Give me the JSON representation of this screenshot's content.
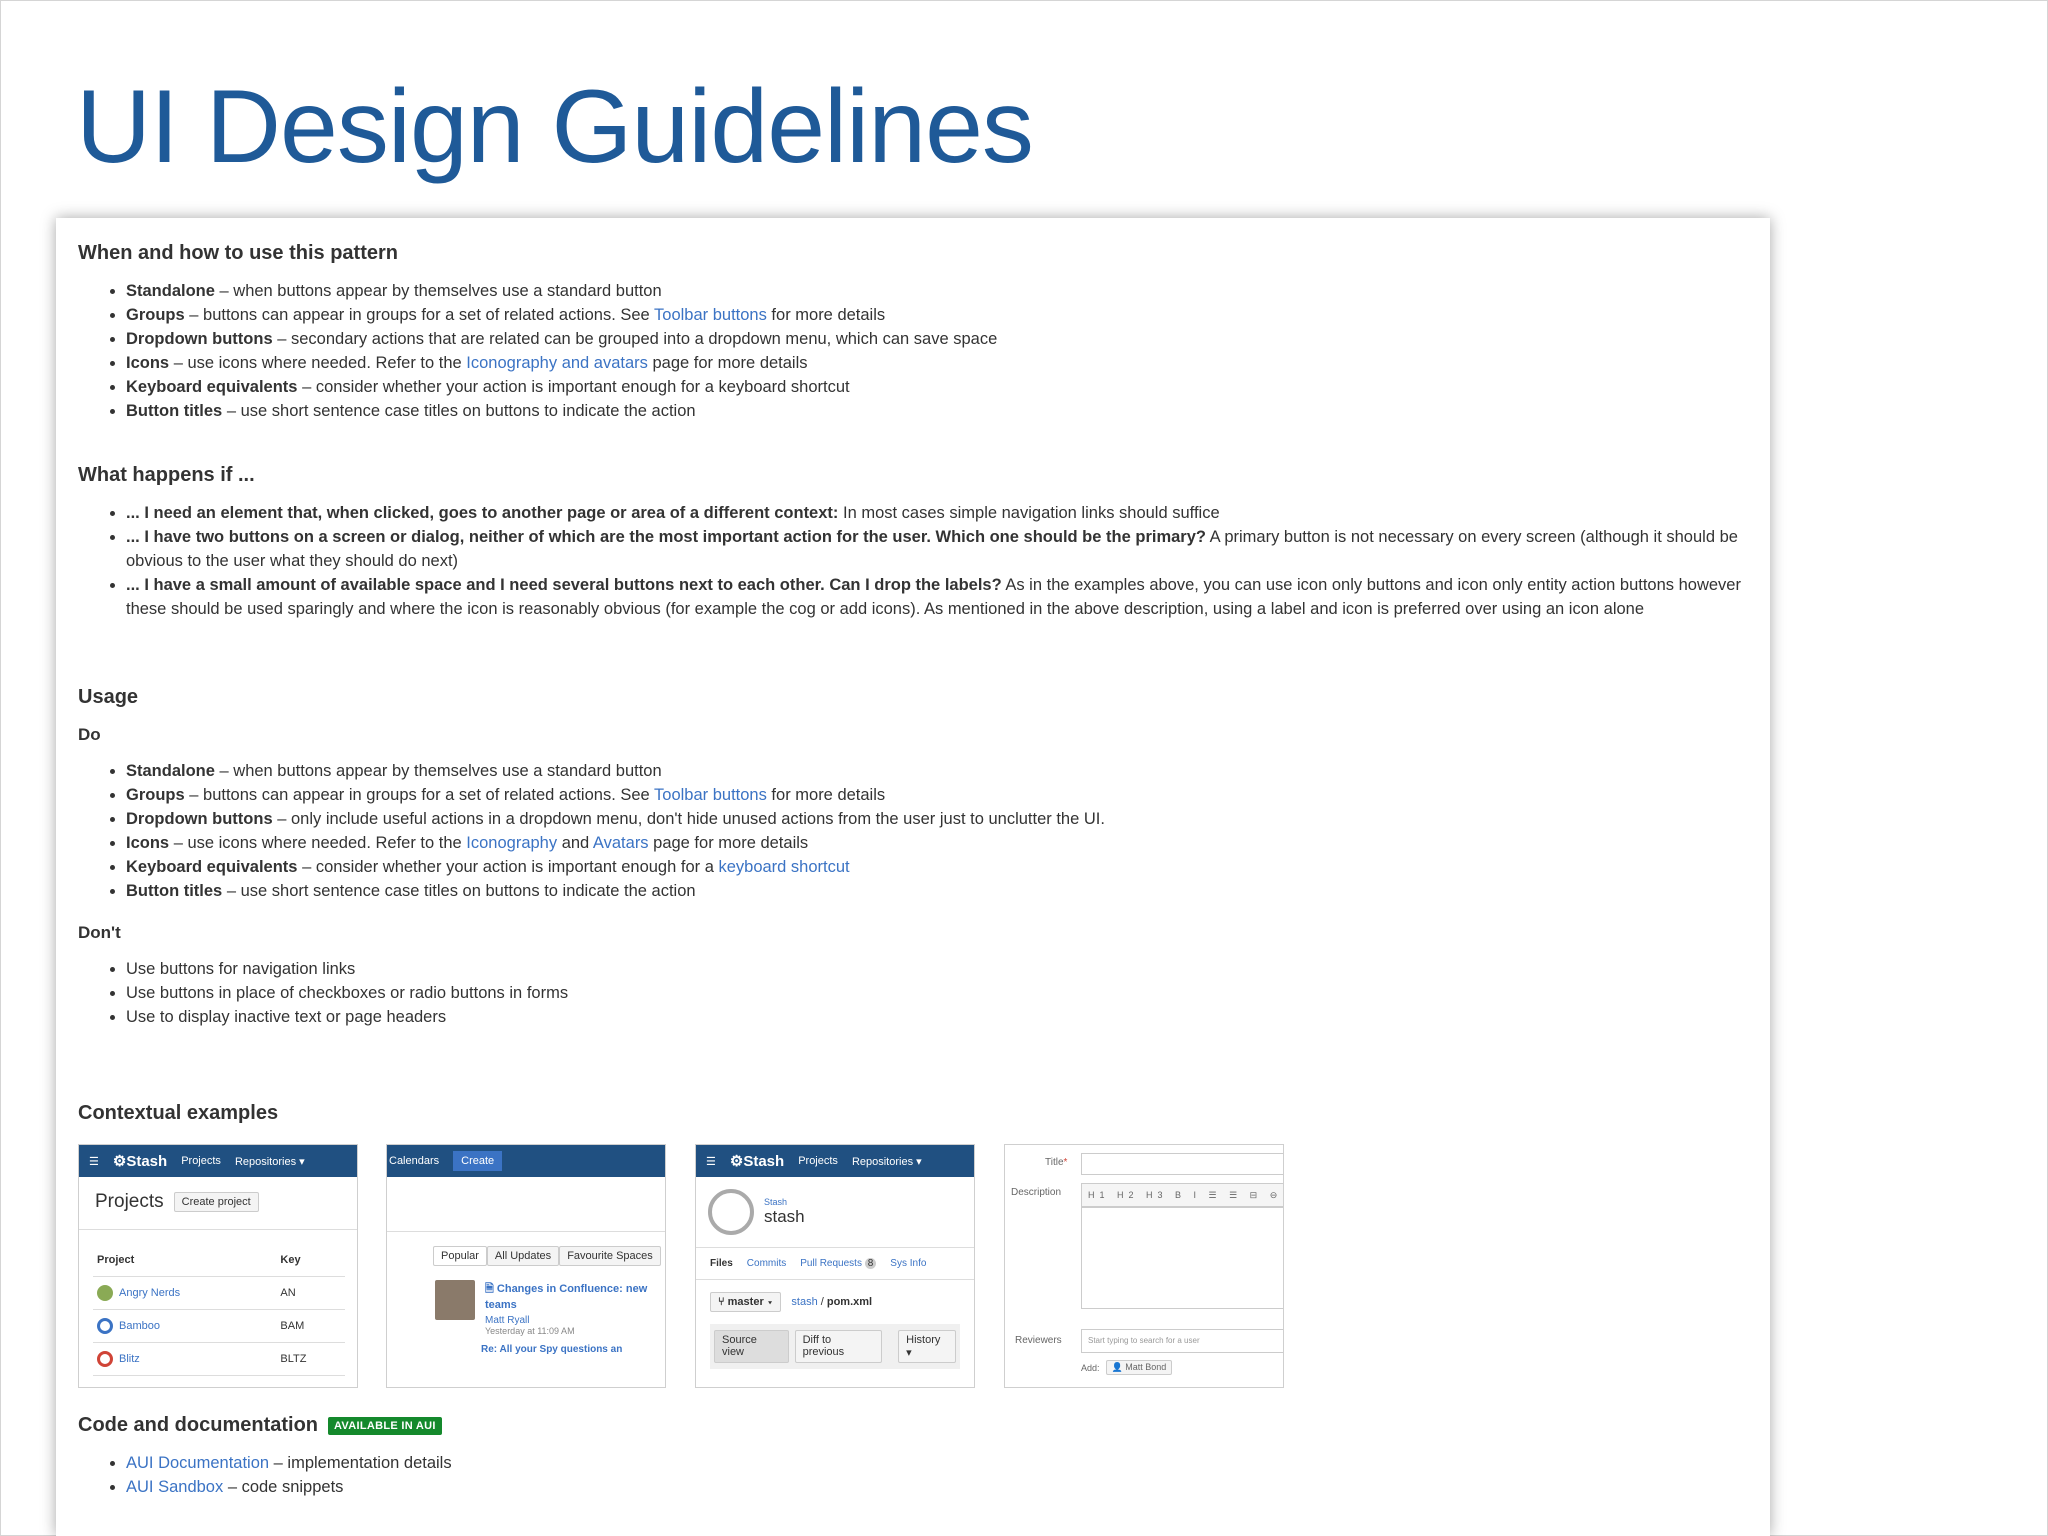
{
  "slide_title": "UI Design Guidelines",
  "when": {
    "heading": "When and how to use this pattern",
    "items": [
      {
        "bold": "Standalone",
        "rest": " – when buttons appear by themselves use a standard button"
      },
      {
        "bold": "Groups",
        "rest": " – buttons can appear in groups for a set of related actions. See ",
        "link": "Toolbar buttons",
        "after": " for more details"
      },
      {
        "bold": "Dropdown buttons",
        "rest": " – secondary actions that are related can be grouped into a dropdown menu, which can save space"
      },
      {
        "bold": "Icons",
        "rest": " – use icons where needed. Refer to the ",
        "link": "Iconography and avatars",
        "after": " page for more details"
      },
      {
        "bold": "Keyboard equivalents",
        "rest": " – consider whether your action is important enough for a keyboard shortcut"
      },
      {
        "bold": "Button titles",
        "rest": " – use short sentence case titles on buttons to indicate the action"
      }
    ]
  },
  "what": {
    "heading": "What happens if ...",
    "items": [
      {
        "bold": "... I need an element that, when clicked, goes to another page or area of a different context:",
        "rest": " In most cases simple navigation links should suffice"
      },
      {
        "bold": "... I have two buttons on a screen or dialog, neither of which are the most important action for the user. Which one should be the primary?",
        "rest": " A primary button is not necessary on every screen (although it should be obvious to the user what they should do next)"
      },
      {
        "bold": "... I have a small amount of available space and I need several buttons next to each other. Can I drop the labels?",
        "rest": " As in the examples above, you can use icon only buttons and icon only entity action buttons however these should be used sparingly and where the icon is reasonably obvious (for example the cog or add icons). As mentioned in the above description, using a label and icon is preferred over using an icon alone"
      }
    ]
  },
  "usage": {
    "heading": "Usage",
    "do_heading": "Do",
    "do_items": [
      {
        "bold": "Standalone",
        "rest": " – when buttons appear by themselves use a standard button"
      },
      {
        "bold": "Groups",
        "rest": " – buttons can appear in groups for a set of related actions. See ",
        "link": "Toolbar buttons",
        "after": " for more details"
      },
      {
        "bold": "Dropdown buttons",
        "rest": " – only include useful actions in a dropdown menu, don't hide unused actions from the user just to unclutter the UI."
      },
      {
        "bold": "Icons",
        "rest": " – use icons where needed. Refer to the ",
        "link": "Iconography",
        "mid": " and ",
        "link2": "Avatars",
        "after": " page for more details"
      },
      {
        "bold": "Keyboard equivalents",
        "rest": " – consider whether your action is important enough for a ",
        "link": "keyboard shortcut"
      },
      {
        "bold": "Button titles",
        "rest": " – use short sentence case titles on buttons to indicate the action"
      }
    ],
    "dont_heading": "Don't",
    "dont_items": [
      "Use buttons for navigation links",
      "Use buttons in place of checkboxes or radio buttons in forms",
      "Use to display inactive text or page headers"
    ]
  },
  "contextual": {
    "heading": "Contextual examples",
    "stash1": {
      "brand": "Stash",
      "nav1": "Projects",
      "nav2": "Repositories ▾",
      "title": "Projects",
      "button": "Create project",
      "col1": "Project",
      "col2": "Key",
      "rows": [
        {
          "name": "Angry Nerds",
          "key": "AN"
        },
        {
          "name": "Bamboo",
          "key": "BAM"
        },
        {
          "name": "Blitz",
          "key": "BLTZ"
        }
      ]
    },
    "confluence": {
      "nav1": "Calendars",
      "nav2": "Create",
      "tabs": [
        "Popular",
        "All Updates",
        "Favourite Spaces"
      ],
      "item_title": "Changes in Confluence: new teams",
      "item_author": "Matt Ryall",
      "item_time": "Yesterday at 11:09 AM",
      "item2": "Re: All your Spy questions an"
    },
    "stash2": {
      "brand": "Stash",
      "nav1": "Projects",
      "nav2": "Repositories ▾",
      "project": "Stash",
      "repo": "stash",
      "tabs": [
        "Files",
        "Commits",
        "Pull Requests",
        "Sys Info"
      ],
      "pr_count": "8",
      "branch": "master ▾",
      "path1": "stash",
      "path2": "pom.xml",
      "btns": [
        "Source view",
        "Diff to previous",
        "History ▾"
      ]
    },
    "form": {
      "title_label": "Title",
      "desc_label": "Description",
      "reviewers_label": "Reviewers",
      "reviewers_placeholder": "Start typing to search for a user",
      "add_label": "Add:",
      "add_user": "Matt Bond"
    }
  },
  "code": {
    "heading": "Code and documentation",
    "badge": "AVAILABLE IN AUI",
    "items": [
      {
        "link": "AUI Documentation",
        "rest": " – implementation details"
      },
      {
        "link": "AUI Sandbox",
        "rest": " – code snippets"
      }
    ]
  }
}
